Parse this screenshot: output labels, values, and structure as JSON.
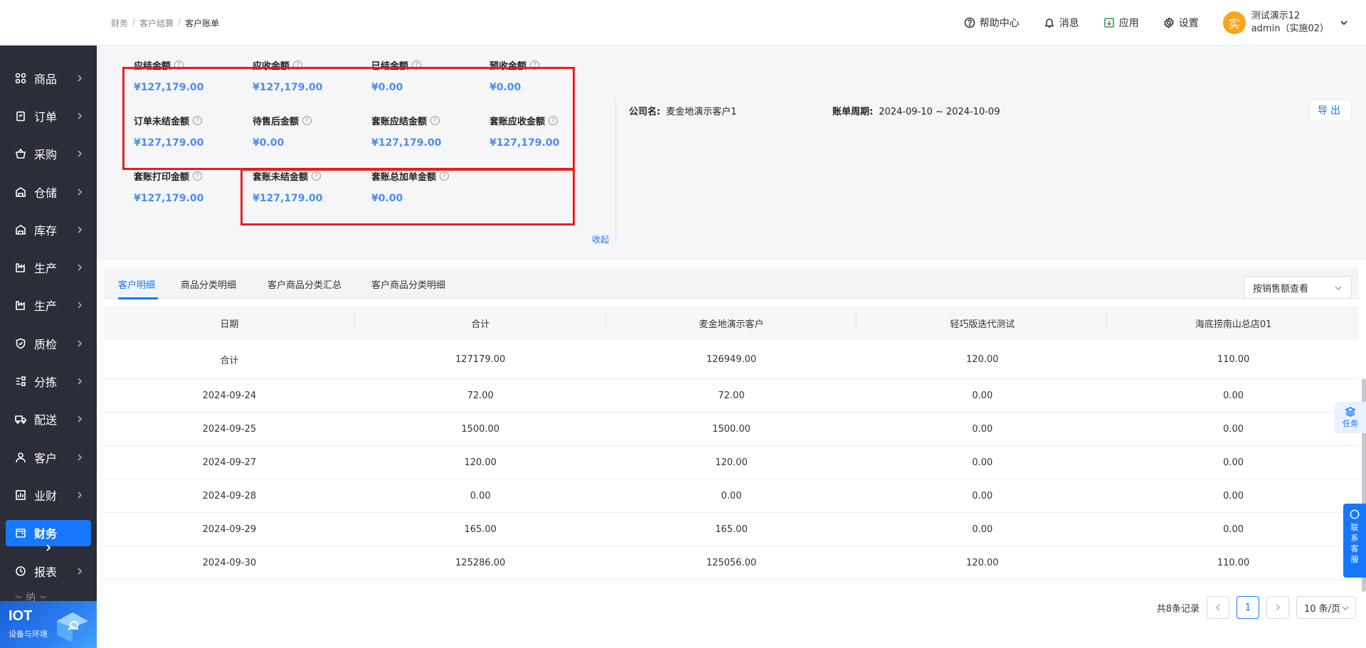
{
  "sidebar": {
    "items": [
      {
        "label": "商品",
        "icon": "grid-icon"
      },
      {
        "label": "订单",
        "icon": "clipboard-icon"
      },
      {
        "label": "采购",
        "icon": "basket-icon"
      },
      {
        "label": "仓储",
        "icon": "warehouse-icon"
      },
      {
        "label": "库存",
        "icon": "warehouse-icon"
      },
      {
        "label": "生产",
        "icon": "factory-icon"
      },
      {
        "label": "生产",
        "icon": "factory-icon"
      },
      {
        "label": "质检",
        "icon": "shield-icon"
      },
      {
        "label": "分拣",
        "icon": "sort-icon"
      },
      {
        "label": "配送",
        "icon": "truck-icon"
      },
      {
        "label": "客户",
        "icon": "user-icon"
      },
      {
        "label": "业财",
        "icon": "bar-chart-icon"
      },
      {
        "label": "财务",
        "icon": "wallet-icon",
        "active": true
      },
      {
        "label": "报表",
        "icon": "clock-icon"
      }
    ],
    "partial_label": "~ 纳 ~",
    "iot": {
      "title": "IOT",
      "subtitle": "设备与环境"
    }
  },
  "topbar": {
    "breadcrumb": [
      "财务",
      "客户结算",
      "客户账单"
    ],
    "help": "帮助中心",
    "messages": "消息",
    "apps": "应用",
    "settings": "设置",
    "user": {
      "avatar": "实",
      "name": "测试演示12",
      "account": "admin（实施02）"
    }
  },
  "summary": {
    "metrics": [
      {
        "label": "应结金额",
        "value": "¥127,179.00"
      },
      {
        "label": "应收金额",
        "value": "¥127,179.00"
      },
      {
        "label": "已结金额",
        "value": "¥0.00"
      },
      {
        "label": "预收金额",
        "value": "¥0.00"
      },
      {
        "label": "订单未结金额",
        "value": "¥127,179.00"
      },
      {
        "label": "待售后金额",
        "value": "¥0.00"
      },
      {
        "label": "套账应结金额",
        "value": "¥127,179.00"
      },
      {
        "label": "套账应收金额",
        "value": "¥127,179.00"
      },
      {
        "label": "套账打印金额",
        "value": "¥127,179.00"
      },
      {
        "label": "套账未结金额",
        "value": "¥127,179.00"
      },
      {
        "label": "套账总加单金额",
        "value": "¥0.00"
      }
    ],
    "collapse": "收起",
    "company_label": "公司名:",
    "company_value": "麦金地演示客户1",
    "period_label": "账单周期:",
    "period_value": "2024-09-10 ~ 2024-10-09",
    "export": "导出"
  },
  "tabs": [
    "客户明细",
    "商品分类明细",
    "客户商品分类汇总",
    "客户商品分类明细"
  ],
  "view_select": "按销售额查看",
  "table": {
    "columns": [
      "日期",
      "合计",
      "麦金地演示客户",
      "轻巧版迭代测试",
      "海底捞南山总店01"
    ],
    "rows": [
      [
        "合计",
        "127179.00",
        "126949.00",
        "120.00",
        "110.00"
      ],
      [
        "2024-09-24",
        "72.00",
        "72.00",
        "0.00",
        "0.00"
      ],
      [
        "2024-09-25",
        "1500.00",
        "1500.00",
        "0.00",
        "0.00"
      ],
      [
        "2024-09-27",
        "120.00",
        "120.00",
        "0.00",
        "0.00"
      ],
      [
        "2024-09-28",
        "0.00",
        "0.00",
        "0.00",
        "0.00"
      ],
      [
        "2024-09-29",
        "165.00",
        "165.00",
        "0.00",
        "0.00"
      ],
      [
        "2024-09-30",
        "125286.00",
        "125056.00",
        "120.00",
        "110.00"
      ]
    ]
  },
  "pagination": {
    "total": "共8条记录",
    "current": "1",
    "page_size": "10 条/页"
  },
  "floating": {
    "task": "任务",
    "service": [
      "联",
      "系",
      "客",
      "服"
    ]
  }
}
